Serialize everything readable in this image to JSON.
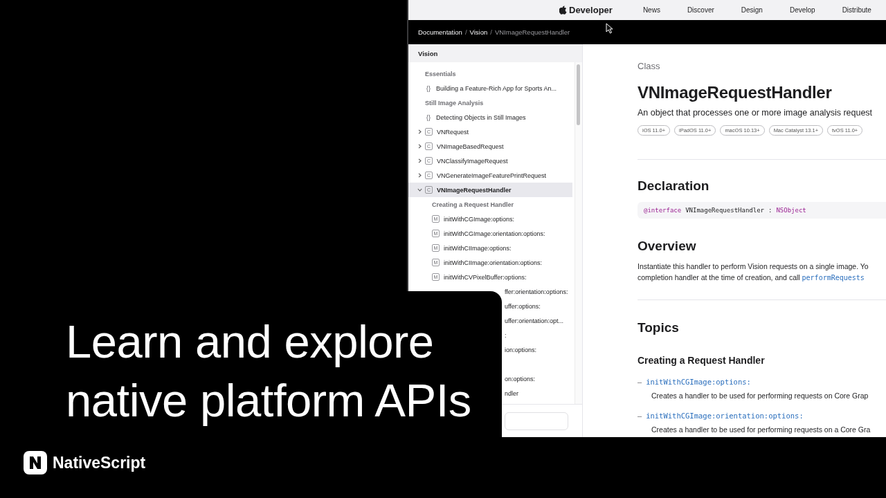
{
  "browser": {
    "nav": {
      "brand": "Developer",
      "links": [
        "News",
        "Discover",
        "Design",
        "Develop",
        "Distribute"
      ]
    },
    "breadcrumbs": {
      "separator": "/",
      "items": [
        {
          "label": "Documentation",
          "current": false
        },
        {
          "label": "Vision",
          "current": false
        },
        {
          "label": "VNImageRequestHandler",
          "current": true
        }
      ]
    },
    "sidebar": {
      "title": "Vision",
      "items": [
        {
          "kind": "section",
          "label": "Essentials"
        },
        {
          "kind": "article",
          "badge": "{}",
          "label": "Building a Feature-Rich App for Sports An...",
          "selected": false
        },
        {
          "kind": "section",
          "label": "Still Image Analysis"
        },
        {
          "kind": "article",
          "badge": "{}",
          "label": "Detecting Objects in Still Images",
          "selected": false
        },
        {
          "kind": "class",
          "badge": "C",
          "label": "VNRequest",
          "expanded": false,
          "selected": false
        },
        {
          "kind": "class",
          "badge": "C",
          "label": "VNImageBasedRequest",
          "expanded": false,
          "selected": false
        },
        {
          "kind": "class",
          "badge": "C",
          "label": "VNClassifyImageRequest",
          "expanded": false,
          "selected": false
        },
        {
          "kind": "class",
          "badge": "C",
          "label": "VNGenerateImageFeaturePrintRequest",
          "expanded": false,
          "selected": false
        },
        {
          "kind": "class",
          "badge": "C",
          "label": "VNImageRequestHandler",
          "expanded": true,
          "selected": true,
          "children": [
            {
              "kind": "section",
              "label": "Creating a Request Handler"
            },
            {
              "kind": "method",
              "badge": "M",
              "label": "initWithCGImage:options:",
              "selected": false
            },
            {
              "kind": "method",
              "badge": "M",
              "label": "initWithCGImage:orientation:options:",
              "selected": false
            },
            {
              "kind": "method",
              "badge": "M",
              "label": "initWithCIImage:options:",
              "selected": false
            },
            {
              "kind": "method",
              "badge": "M",
              "label": "initWithCIImage:orientation:options:",
              "selected": false
            },
            {
              "kind": "method",
              "badge": "M",
              "label": "initWithCVPixelBuffer:options:",
              "selected": false
            },
            {
              "kind": "fragment",
              "label": "ffer:orientation:options:"
            },
            {
              "kind": "fragment",
              "label": "uffer:options:"
            },
            {
              "kind": "fragment",
              "label": "uffer:orientation:opt..."
            },
            {
              "kind": "fragment",
              "label": ":"
            },
            {
              "kind": "fragment",
              "label": "ion:options:"
            },
            {
              "kind": "covered"
            },
            {
              "kind": "fragment",
              "label": "on:options:"
            },
            {
              "kind": "fragment",
              "label": "ndler"
            }
          ]
        }
      ]
    },
    "content": {
      "eyebrow": "Class",
      "title": "VNImageRequestHandler",
      "abstract": "An object that processes one or more image analysis request",
      "platforms": [
        "iOS 11.0+",
        "iPadOS 11.0+",
        "macOS 10.13+",
        "Mac Catalyst 13.1+",
        "tvOS 11.0+"
      ],
      "declaration": {
        "heading": "Declaration",
        "code": [
          {
            "kind": "keyword",
            "text": "@interface"
          },
          {
            "kind": "plain",
            "text": "VNImageRequestHandler"
          },
          {
            "kind": "plain",
            "text": ":"
          },
          {
            "kind": "type",
            "text": "NSObject"
          }
        ]
      },
      "overview": {
        "heading": "Overview",
        "lines": [
          [
            {
              "kind": "plain",
              "text": "Instantiate this handler to perform Vision requests on a single image. Yo"
            }
          ],
          [
            {
              "kind": "plain",
              "text": "completion handler at the time of creation, and call "
            },
            {
              "kind": "link",
              "text": "performRequests"
            }
          ]
        ]
      },
      "topics": {
        "heading": "Topics",
        "groups": [
          {
            "heading": "Creating a Request Handler",
            "items": [
              {
                "marker": "–",
                "name": "initWithCGImage:options:",
                "description": "Creates a handler to be used for performing requests on Core Grap"
              },
              {
                "marker": "–",
                "name": "initWithCGImage:orientation:options:",
                "description": "Creates a handler to be used for performing requests on a Core Gra"
              }
            ]
          }
        ]
      }
    }
  },
  "caption": {
    "lines": [
      "Learn and explore",
      "native platform APIs"
    ]
  },
  "brand": {
    "name": "NativeScript"
  }
}
